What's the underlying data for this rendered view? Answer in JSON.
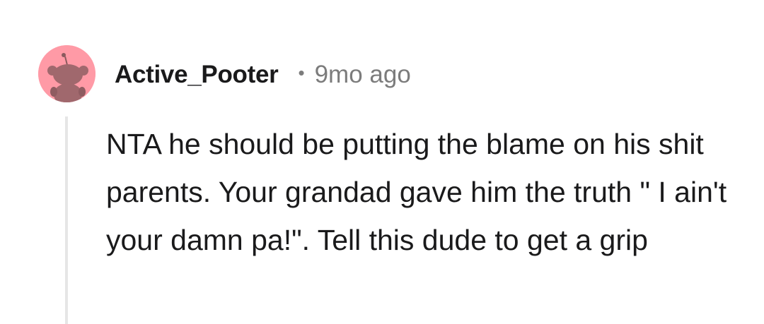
{
  "comment": {
    "author": "Active_Pooter",
    "separator": "•",
    "age": "9mo ago",
    "avatar_icon": "reddit-snoo-avatar-icon",
    "avatar_color": "#ff9aa6",
    "body": "NTA he should be putting the blame on his shit parents. Your grandad gave him the truth \" I ain't your damn pa!\". Tell this dude to get a grip"
  }
}
